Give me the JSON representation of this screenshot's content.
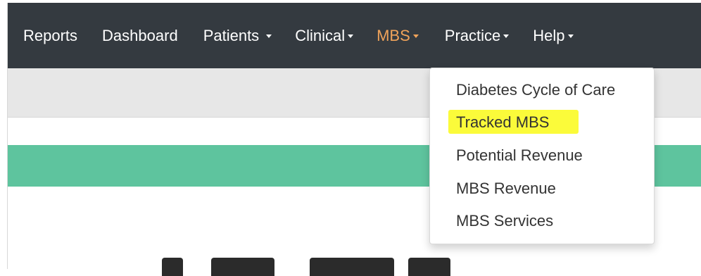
{
  "navbar": {
    "items": [
      {
        "label": "Reports",
        "dropdown": false,
        "active": false
      },
      {
        "label": "Dashboard",
        "dropdown": false,
        "active": false
      },
      {
        "label": "Patients",
        "dropdown": true,
        "active": false
      },
      {
        "label": "Clinical",
        "dropdown": true,
        "active": false
      },
      {
        "label": "MBS",
        "dropdown": true,
        "active": true
      },
      {
        "label": "Practice",
        "dropdown": true,
        "active": false
      },
      {
        "label": "Help",
        "dropdown": true,
        "active": false
      }
    ],
    "colors": {
      "background": "#343a40",
      "text": "#ffffff",
      "active": "#f0a35a"
    }
  },
  "mbs_menu": {
    "items": [
      {
        "label": "Diabetes Cycle of Care",
        "highlighted": false
      },
      {
        "label": "Tracked MBS",
        "highlighted": true
      },
      {
        "label": "Potential Revenue",
        "highlighted": false
      },
      {
        "label": "MBS Revenue",
        "highlighted": false
      },
      {
        "label": "MBS Services",
        "highlighted": false
      }
    ],
    "highlight_color": "#fbfb3a"
  },
  "banner": {
    "color": "#5ec49e"
  }
}
